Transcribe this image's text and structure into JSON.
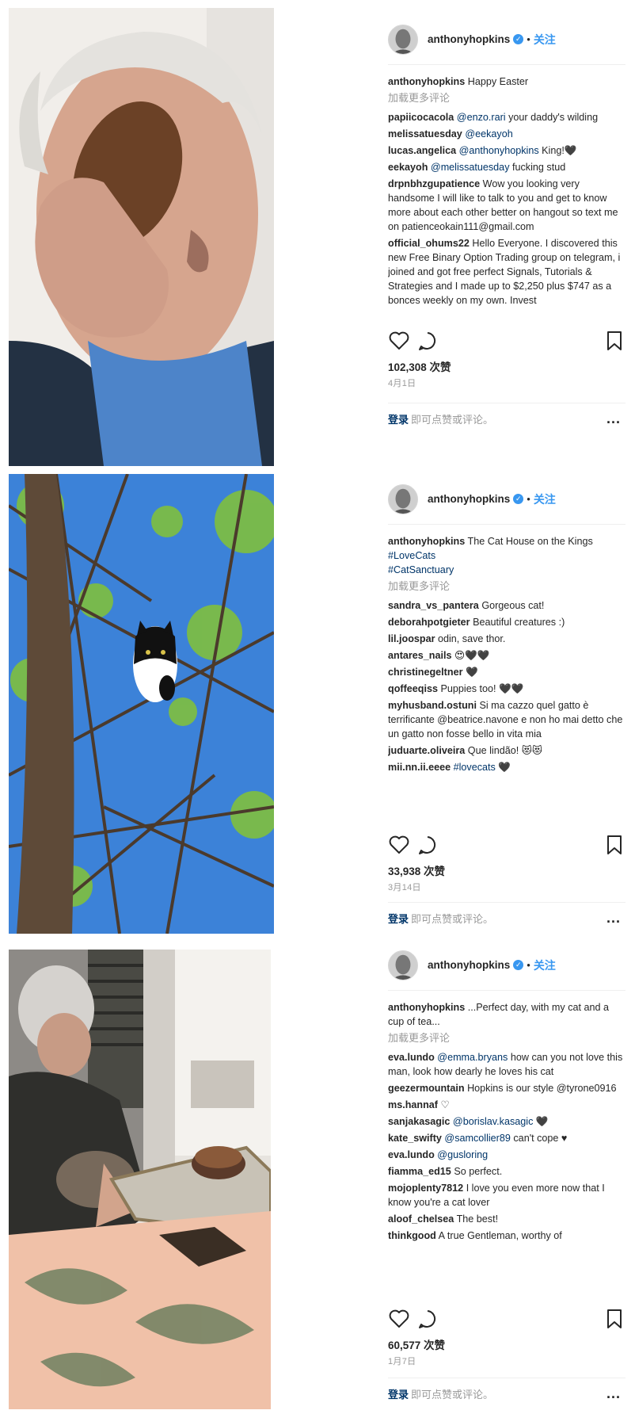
{
  "posts": [
    {
      "username": "anthonyhopkins",
      "follow_label": "关注",
      "caption_user": "anthonyhopkins",
      "caption_text": "Happy Easter",
      "load_more": "加载更多评论",
      "comments": [
        {
          "user": "papiicocacola",
          "mention": "@enzo.rari",
          "text": " your daddy's wilding"
        },
        {
          "user": "melissatuesday",
          "mention": "@eekayoh",
          "text": ""
        },
        {
          "user": "lucas.angelica",
          "mention": "@anthonyhopkins",
          "text": " King!🖤"
        },
        {
          "user": "eekayoh",
          "mention": "@melissatuesday",
          "text": " fucking stud"
        },
        {
          "user": "drpnbhzgupatience",
          "mention": "",
          "text": "Wow you looking very handsome I will like to talk to you and get to know more about each other better on hangout so text me on patienceokain111@gmail.com"
        },
        {
          "user": "official_ohums22",
          "mention": "",
          "text": "Hello Everyone. I discovered this new Free Binary Option Trading group on telegram, i joined and got free perfect Signals, Tutorials & Strategies and I made up to $2,250 plus $747 as a bonces weekly on my own. Invest"
        }
      ],
      "likes": "102,308 次赞",
      "date": "4月1日",
      "login_link": "登录",
      "login_text": "即可点赞或评论。",
      "more_icon": "..."
    },
    {
      "username": "anthonyhopkins",
      "follow_label": "关注",
      "caption_user": "anthonyhopkins",
      "caption_text": "The Cat House on the Kings",
      "hashtags": [
        "#LoveCats",
        "#CatSanctuary"
      ],
      "load_more": "加载更多评论",
      "comments": [
        {
          "user": "sandra_vs_pantera",
          "mention": "",
          "text": "Gorgeous cat!"
        },
        {
          "user": "deborahpotgieter",
          "mention": "",
          "text": "Beautiful creatures :)"
        },
        {
          "user": "lil.joospar",
          "mention": "",
          "text": "odin, save thor."
        },
        {
          "user": "antares_nails",
          "mention": "",
          "text": "😍🖤🖤"
        },
        {
          "user": "christinegeltner",
          "mention": "",
          "text": "🖤"
        },
        {
          "user": "qoffeeqiss",
          "mention": "",
          "text": "Puppies too! 🖤🖤"
        },
        {
          "user": "myhusband.ostuni",
          "mention": "",
          "text": "Si ma cazzo quel gatto è terrificante @beatrice.navone e non ho mai detto che un gatto non fosse bello in vita mia"
        },
        {
          "user": "juduarte.oliveira",
          "mention": "",
          "text": "Que lindão! 😻😻"
        },
        {
          "user": "mii.nn.ii.eeee",
          "mention": "#lovecats",
          "text": " 🖤"
        }
      ],
      "likes": "33,938 次赞",
      "date": "3月14日",
      "login_link": "登录",
      "login_text": "即可点赞或评论。",
      "more_icon": "..."
    },
    {
      "username": "anthonyhopkins",
      "follow_label": "关注",
      "caption_user": "anthonyhopkins",
      "caption_text": "...Perfect day, with my cat and a cup of tea...",
      "load_more": "加载更多评论",
      "comments": [
        {
          "user": "eva.lundo",
          "mention": "@emma.bryans",
          "text": " how can you not love this man, look how dearly he loves his cat"
        },
        {
          "user": "geezermountain",
          "mention": "",
          "text": "Hopkins is our style @tyrone0916"
        },
        {
          "user": "ms.hannaf",
          "mention": "",
          "text": "♡"
        },
        {
          "user": "sanjakasagic",
          "mention": "@borislav.kasagic",
          "text": " 🖤"
        },
        {
          "user": "kate_swifty",
          "mention": "@samcollier89",
          "text": " can't cope ♥"
        },
        {
          "user": "eva.lundo",
          "mention": "@gusloring",
          "text": ""
        },
        {
          "user": "fiamma_ed15",
          "mention": "",
          "text": "So perfect."
        },
        {
          "user": "mojoplenty7812",
          "mention": "",
          "text": "I love you even more now that I know you're a cat lover"
        },
        {
          "user": "aloof_chelsea",
          "mention": "",
          "text": "The best!"
        },
        {
          "user": "thinkgood",
          "mention": "",
          "text": "A true Gentleman, worthy of"
        }
      ],
      "likes": "60,577 次赞",
      "date": "1月7日",
      "login_link": "登录",
      "login_text": "即可点赞或评论。",
      "more_icon": "..."
    }
  ],
  "icons": {
    "like": "heart-icon",
    "comment": "comment-icon",
    "save": "bookmark-icon",
    "verified": "verified-badge-icon"
  },
  "colors": {
    "link_blue": "#3897f0",
    "mention_blue": "#003569",
    "muted": "#999999",
    "divider": "#efefef"
  }
}
